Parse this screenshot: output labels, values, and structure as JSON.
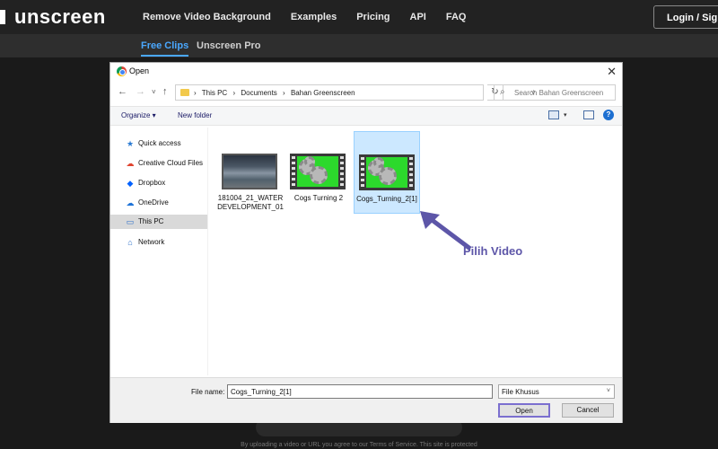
{
  "site": {
    "logo": "unscreen",
    "nav": [
      "Remove Video Background",
      "Examples",
      "Pricing",
      "API",
      "FAQ"
    ],
    "login": "Login / Sign",
    "subnav_active": "Free Clips",
    "subnav_other": "Unscreen Pro",
    "footer": "By uploading a video or URL you agree to our Terms of Service. This site is protected"
  },
  "dialog": {
    "title": "Open",
    "close": "✕",
    "nav_back": "←",
    "nav_forward": "→",
    "nav_recent": "˅",
    "nav_up": "↑",
    "breadcrumbs": [
      "›",
      "This PC",
      "›",
      "Documents",
      "›",
      "Bahan Greenscreen"
    ],
    "address_dropdown": "˅",
    "refresh": "↻",
    "search_placeholder": "Search Bahan Greenscreen",
    "toolbar": {
      "organize": "Organize ▾",
      "new_folder": "New folder",
      "view_dropdown": "▾",
      "help": "?"
    },
    "nav_pane": [
      {
        "label": "Quick access",
        "icon": "★"
      },
      {
        "label": "Creative Cloud Files",
        "icon": "☁"
      },
      {
        "label": "Dropbox",
        "icon": "◆"
      },
      {
        "label": "OneDrive",
        "icon": "☁"
      },
      {
        "label": "This PC",
        "icon": "▭"
      },
      {
        "label": "Network",
        "icon": "⌂"
      }
    ],
    "files": [
      {
        "name": "181004_21_WATERDEVELOPMENT_01"
      },
      {
        "name": "Cogs Turning 2"
      },
      {
        "name": "Cogs_Turning_2[1]"
      }
    ],
    "annotation": "Pilih Video",
    "file_name_label": "File name:",
    "file_name_value": "Cogs_Turning_2[1]",
    "file_type": "File Khusus",
    "file_type_dropdown": "˅",
    "open_button": "Open",
    "cancel_button": "Cancel"
  },
  "colors": {
    "accent_tab": "#4aa8ff",
    "annotation": "#5d56a8",
    "selection": "#cce8ff",
    "green_screen": "#2cd92c"
  }
}
